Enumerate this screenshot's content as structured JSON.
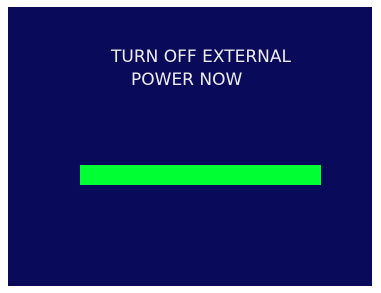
{
  "screen": {
    "background_color": "#0a0a5a",
    "message_lines": [
      "TURN OFF EXTERNAL",
      "POWER NOW"
    ],
    "text_color": "#ececec"
  },
  "progress": {
    "value": 1.0,
    "color": "#00ff33"
  }
}
